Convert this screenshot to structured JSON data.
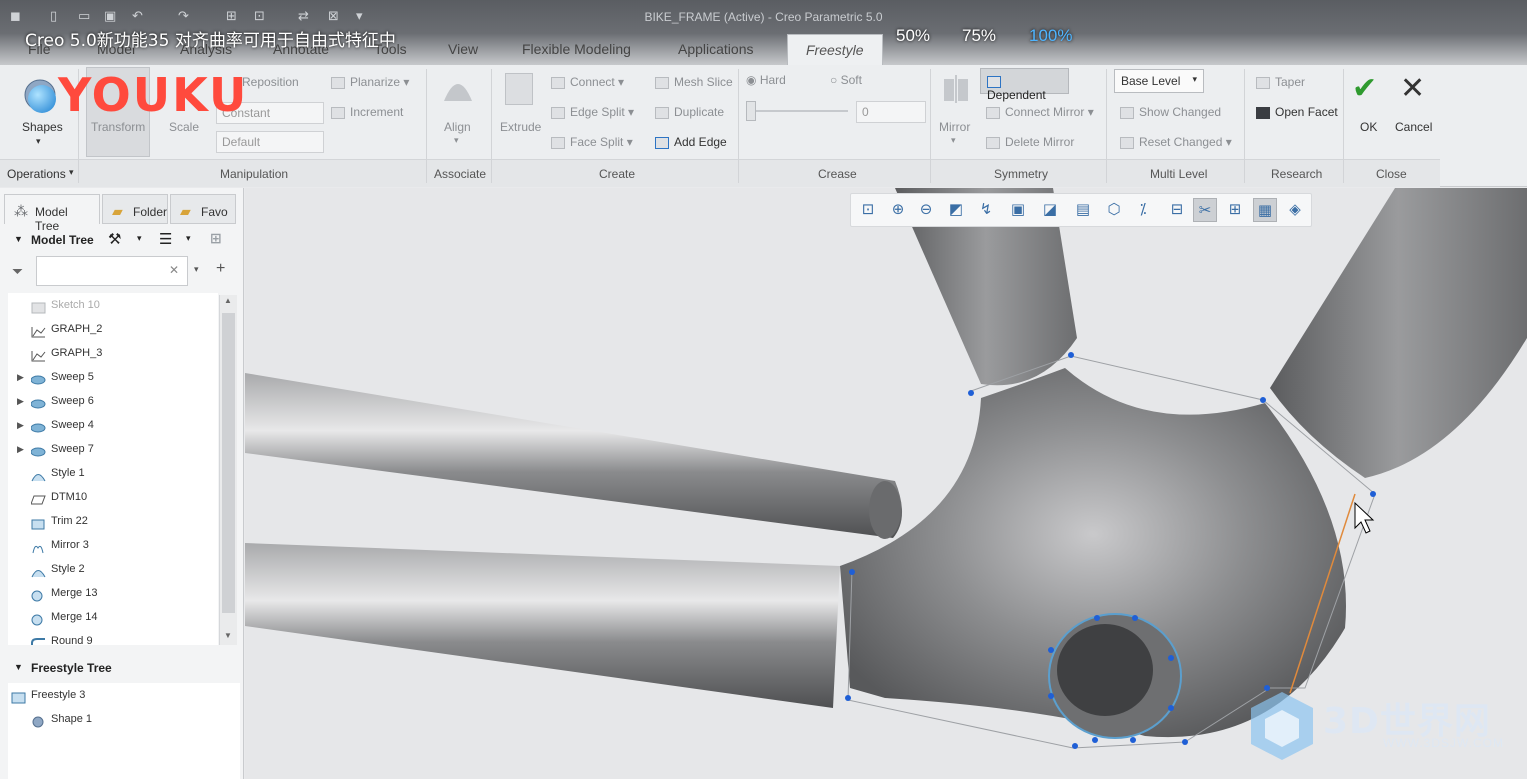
{
  "window": {
    "title": "BIKE_FRAME (Active) - Creo Parametric 5.0",
    "quick_access": [
      "◼",
      "▯",
      "▭",
      "▣",
      "↶",
      "↷",
      "⊞",
      "⊡",
      "⇄",
      "⊠",
      "▾"
    ]
  },
  "overlay": {
    "video_title": "Creo 5.0新功能35 对齐曲率可用于自由式特征中",
    "zoom_options": [
      "50%",
      "75%",
      "100%"
    ],
    "logo": "YOUKU",
    "zoom_selected_color": "#4fb5ff"
  },
  "tabs": [
    "File",
    "Model",
    "Analysis",
    "Annotate",
    "Tools",
    "View",
    "Flexible Modeling",
    "Applications",
    "Freestyle"
  ],
  "ribbon": {
    "shapes": "Shapes",
    "transform": "Transform",
    "scale": "Scale",
    "reposition": "Reposition",
    "planarize": "Planarize",
    "increment": "Increment",
    "constant": "Constant",
    "default": "Default",
    "align": "Align",
    "extrude": "Extrude",
    "connect": "Connect",
    "edge_split": "Edge Split",
    "face_split": "Face Split",
    "mesh_slice": "Mesh Slice",
    "duplicate": "Duplicate",
    "add_edge": "Add Edge",
    "hard": "Hard",
    "soft": "Soft",
    "crease_value": "0",
    "mirror": "Mirror",
    "dependent": "Dependent",
    "connect_mirror": "Connect Mirror",
    "delete_mirror": "Delete Mirror",
    "base_level": "Base Level",
    "show_changed": "Show Changed",
    "reset_changed": "Reset Changed",
    "taper": "Taper",
    "open_facet": "Open Facet",
    "ok": "OK",
    "cancel": "Cancel",
    "groups": [
      "Operations",
      "Manipulation",
      "Associate",
      "Create",
      "Crease",
      "Symmetry",
      "Multi Level",
      "Research",
      "Close"
    ]
  },
  "left_panel": {
    "tabs": [
      "Model Tree",
      "Folder",
      "Favo"
    ],
    "model_tree_title": "Model Tree",
    "search_placeholder": "",
    "tree_items": [
      {
        "label": "Sketch 10",
        "icon": "sketch-icon",
        "faded": true,
        "expand": false
      },
      {
        "label": "GRAPH_2",
        "icon": "graph-icon",
        "faded": false,
        "expand": false
      },
      {
        "label": "GRAPH_3",
        "icon": "graph-icon",
        "faded": false,
        "expand": false
      },
      {
        "label": "Sweep 5",
        "icon": "sweep-icon",
        "faded": false,
        "expand": true
      },
      {
        "label": "Sweep 6",
        "icon": "sweep-icon",
        "faded": false,
        "expand": true
      },
      {
        "label": "Sweep 4",
        "icon": "sweep-icon",
        "faded": false,
        "expand": true
      },
      {
        "label": "Sweep 7",
        "icon": "sweep-icon",
        "faded": false,
        "expand": true
      },
      {
        "label": "Style 1",
        "icon": "style-icon",
        "faded": false,
        "expand": false
      },
      {
        "label": "DTM10",
        "icon": "datum-plane-icon",
        "faded": false,
        "expand": false
      },
      {
        "label": "Trim 22",
        "icon": "trim-icon",
        "faded": false,
        "expand": false
      },
      {
        "label": "Mirror 3",
        "icon": "mirror-icon",
        "faded": false,
        "expand": false
      },
      {
        "label": "Style 2",
        "icon": "style-icon",
        "faded": false,
        "expand": false
      },
      {
        "label": "Merge 13",
        "icon": "merge-icon",
        "faded": false,
        "expand": false
      },
      {
        "label": "Merge 14",
        "icon": "merge-icon",
        "faded": false,
        "expand": false
      },
      {
        "label": "Round 9",
        "icon": "round-icon",
        "faded": false,
        "expand": false
      }
    ],
    "freestyle_tree_title": "Freestyle Tree",
    "freestyle_items": [
      {
        "label": "Freestyle 3",
        "icon": "freestyle-icon"
      },
      {
        "label": "Shape 1",
        "icon": "shape-icon"
      }
    ]
  },
  "watermark": {
    "text": "3D世界网",
    "url": "WWW.3DSJW.COM"
  },
  "colors": {
    "accent": "#2d74c4",
    "ok_green": "#2f9a2f",
    "frame_gray": "#8a8b8d",
    "control_point": "#1f5fd6",
    "highlight_edge": "#e08a3c"
  }
}
